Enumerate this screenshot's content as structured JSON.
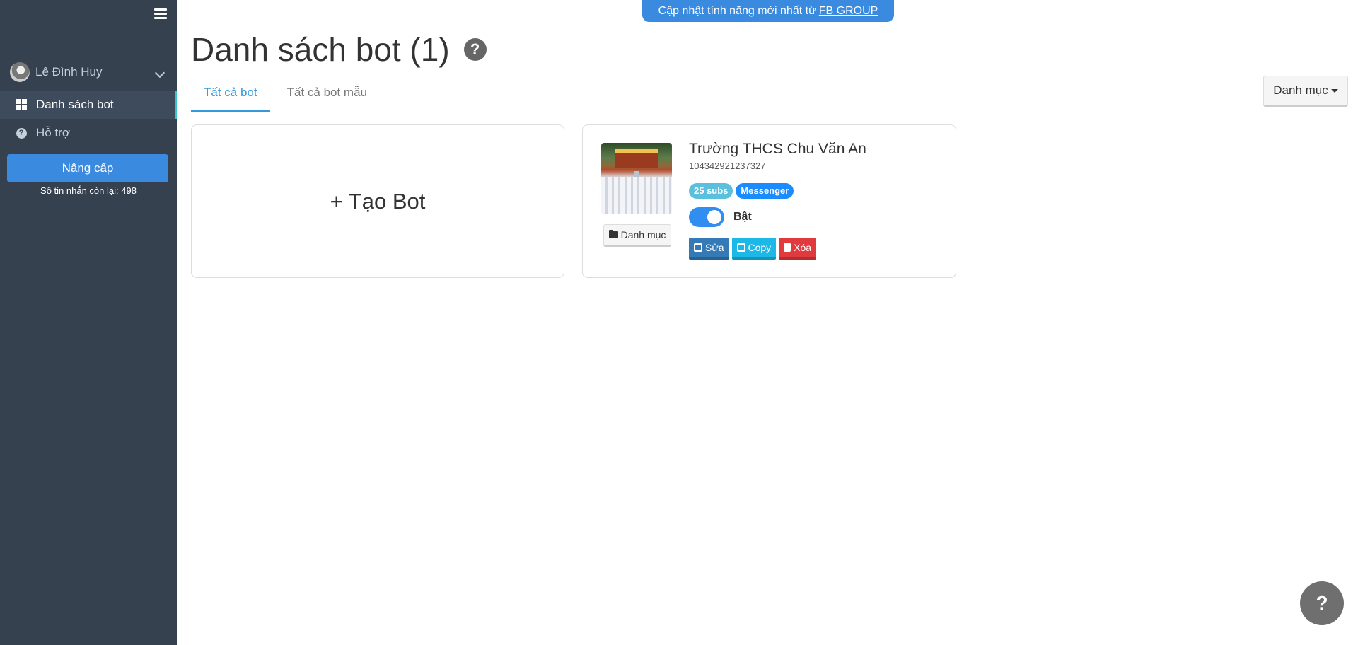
{
  "banner": {
    "text": "Cập nhật tính năng mới nhất từ",
    "link": "FB GROUP"
  },
  "sidebar": {
    "user_name": "Lê Đình Huy",
    "items": [
      {
        "label": "Danh sách bot",
        "icon": "grid-icon",
        "active": true
      },
      {
        "label": "Hỗ trợ",
        "icon": "question-circle-icon",
        "active": false
      }
    ],
    "upgrade_label": "Nâng cấp",
    "messages_left": "Số tin nhắn còn lại: 498"
  },
  "page": {
    "title": "Danh sách bot (1)",
    "tabs": [
      {
        "label": "Tất cả bot",
        "active": true
      },
      {
        "label": "Tất cả bot mẫu",
        "active": false
      }
    ],
    "category_button": "Danh mục"
  },
  "create_card": {
    "label": "+ Tạo Bot"
  },
  "bots": [
    {
      "name": "Trường THCS Chu Văn An",
      "id": "104342921237327",
      "subs_badge": "25 subs",
      "platform_badge": "Messenger",
      "enabled": true,
      "toggle_label": "Bật",
      "category_button": "Danh mục",
      "actions": {
        "edit": "Sửa",
        "copy": "Copy",
        "delete": "Xóa"
      }
    }
  ],
  "help_fab": "?"
}
